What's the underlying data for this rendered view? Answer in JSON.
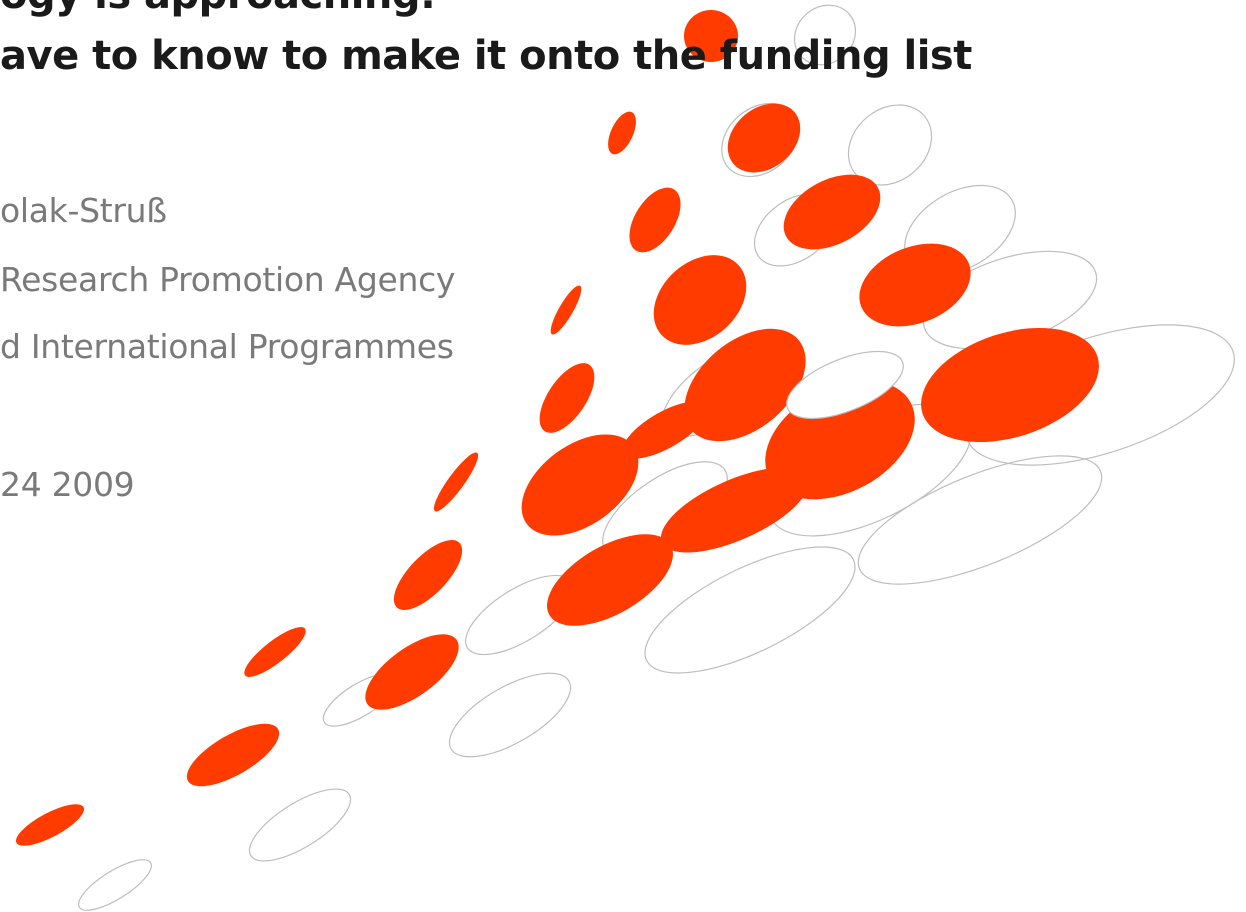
{
  "slide": {
    "title_line_1": "ogy is approaching:",
    "title_line_2": "ave to know to make it onto the funding list",
    "presenter": "olak-Struß",
    "organisation": "Research Promotion Agency",
    "department": "d International Programmes",
    "date": "24 2009"
  },
  "colors": {
    "accent": "#ff3b00",
    "title_text": "#1a1a1a",
    "body_text": "#7a7a7a",
    "outline": "#bdbdbd",
    "background": "#ffffff"
  }
}
